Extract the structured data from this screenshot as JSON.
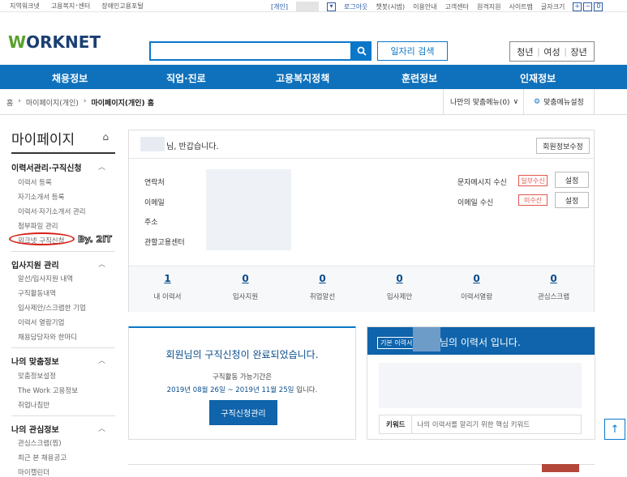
{
  "topbar": {
    "left_links": [
      "지역워크넷",
      "고용복지⁺센터",
      "장애인고용포털"
    ],
    "user_type": "[개인]",
    "right_links": [
      "로그아웃",
      "챗봇(시범)",
      "이용안내",
      "고객센터",
      "원격지원",
      "사이트맵",
      "글자크기"
    ],
    "font_controls": [
      "+",
      "−",
      "0"
    ]
  },
  "header": {
    "logo_w": "W",
    "logo_rest": "ORKNET",
    "search_placeholder": "",
    "job_search_label": "일자리 검색",
    "segments": [
      "청년",
      "여성",
      "장년"
    ]
  },
  "gnb": [
    "채용정보",
    "직업·진로",
    "고용복지정책",
    "훈련정보",
    "인재정보"
  ],
  "breadcrumb": {
    "items": [
      "홈",
      "마이페이지(개인)",
      "마이페이지(개인) 홈"
    ],
    "my_menu": "나만의 맞춤메뉴(0)",
    "menu_setting": "맞춤메뉴설정"
  },
  "lnb": {
    "title": "마이페이지",
    "sections": [
      {
        "title": "이력서관리·구직신청",
        "items": [
          "이력서 등록",
          "자기소개서 등록",
          "이력서·자기소개서 관리",
          "첨부파일 관리",
          "워크넷 구직신청"
        ]
      },
      {
        "title": "입사지원 관리",
        "items": [
          "알선/입사지원 내역",
          "구직활동내역",
          "입사제안/스크랩한 기업",
          "이력서 열람기업",
          "채용담당자와 한마디"
        ]
      },
      {
        "title": "나의 맞춤정보",
        "items": [
          "맞춤정보설정",
          "The Work 고용정보",
          "취업나침반"
        ]
      },
      {
        "title": "나의 관심정보",
        "items": [
          "관심스크랩(찜)",
          "최근 본 채용공고",
          "마이캘린더"
        ]
      }
    ],
    "watermark": "By. 2IT"
  },
  "profile": {
    "greeting": "님, 반갑습니다.",
    "edit_button": "회원정보수정",
    "fields": [
      "연락처",
      "이메일",
      "주소",
      "관할고용센터"
    ],
    "sms_label": "문자메시지 수신",
    "sms_status": "일부수신",
    "email_label": "이메일 수신",
    "email_status": "미수신",
    "setting_label": "설정"
  },
  "stats": [
    {
      "value": "1",
      "label": "내 이력서"
    },
    {
      "value": "0",
      "label": "입사지원"
    },
    {
      "value": "0",
      "label": "취업알선"
    },
    {
      "value": "0",
      "label": "입사제안"
    },
    {
      "value": "0",
      "label": "이력서열람"
    },
    {
      "value": "0",
      "label": "관심스크랩"
    }
  ],
  "jobseek": {
    "title": "회원님의 구직신청이 완료되었습니다.",
    "period_label": "구직활동 가능기간은",
    "period_value": "2019년 08월 26일 ~ 2019년 11월 25일",
    "period_suffix": " 입니다.",
    "button": "구직신청관리"
  },
  "resume": {
    "tag": "기본 이력서",
    "title": "님의 이력서 입니다.",
    "keyword_label": "키워드",
    "keyword_text": "나의 이력서를 알리기 위한 핵심 키워드"
  },
  "colors": {
    "primary": "#0f71bc",
    "accent_red": "#e0574d",
    "logo_green": "#5aa02c"
  }
}
